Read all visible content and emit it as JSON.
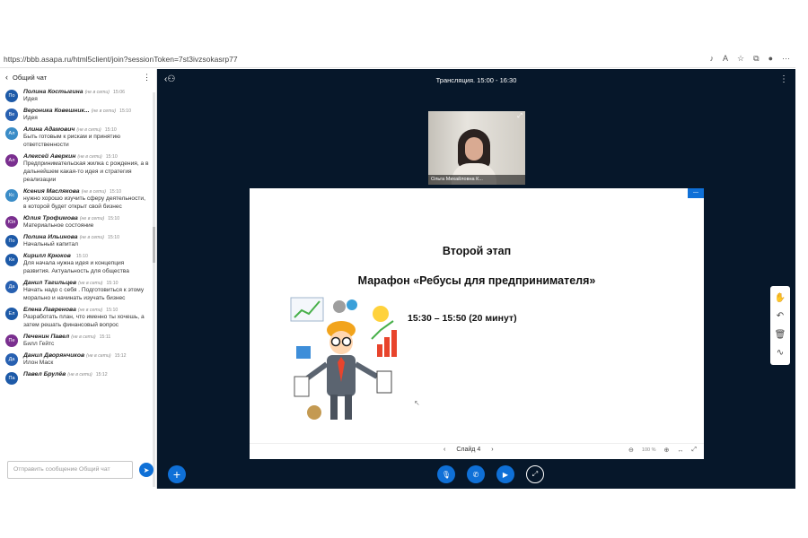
{
  "browser": {
    "url": "https://bbb.asapa.ru/html5client/join?sessionToken=7st3ivzsokasrp77",
    "icons": [
      "microphone-icon",
      "reading-icon",
      "favorite-icon",
      "collections-icon",
      "profile-icon",
      "more-icon"
    ]
  },
  "chat": {
    "back_symbol": "‹",
    "title": "Общий чат",
    "messages": [
      {
        "initials": "По",
        "color": "#1d5aa8",
        "name": "Полина Костыгина",
        "status": "(не в сети)",
        "time": "15:06",
        "text": "Идея"
      },
      {
        "initials": "Ве",
        "color": "#2760b1",
        "name": "Вероника Ковешник...",
        "status": "(не в сети)",
        "time": "15:10",
        "text": "Идея"
      },
      {
        "initials": "Ал",
        "color": "#3a8cc7",
        "name": "Алина Адамович",
        "status": "(не в сети)",
        "time": "15:10",
        "text": "Быть готовым к рискам и принятию ответственности"
      },
      {
        "initials": "Ал",
        "color": "#7a2f8f",
        "name": "Алексей Аверкин",
        "status": "(не в сети)",
        "time": "15:10",
        "text": "Предпринимательская жилка с рождения, а в дальнейшем какая-то идея и стратегия реализации"
      },
      {
        "initials": "Кс",
        "color": "#3a8cc7",
        "name": "Ксения Маслякова",
        "status": "(не в сети)",
        "time": "15:10",
        "text": "нужно хорошо изучить сферу деятельности, в которой будет открыт свой бизнес"
      },
      {
        "initials": "Юл",
        "color": "#7a2f8f",
        "name": "Юлия Трофимова",
        "status": "(не в сети)",
        "time": "15:10",
        "text": "Материальное состояние"
      },
      {
        "initials": "По",
        "color": "#1d5aa8",
        "name": "Полина Ильинова",
        "status": "(не в сети)",
        "time": "15:10",
        "text": "Начальный капитал"
      },
      {
        "initials": "Ки",
        "color": "#1d5aa8",
        "name": "Кирилл Крюков",
        "status": "",
        "time": "15:10",
        "text": "Для начала нужна идея и концепция развития. Актуальность для общества"
      },
      {
        "initials": "Да",
        "color": "#2760b1",
        "name": "Данил Тагильцев",
        "status": "(не в сети)",
        "time": "15:10",
        "text": "Начать надо с себя . Подготовиться к этому морально и начинать изучать бизнес"
      },
      {
        "initials": "Ел",
        "color": "#1d5aa8",
        "name": "Елена Лавренова",
        "status": "(не в сети)",
        "time": "15:10",
        "text": "Разработать план, что именно ты хочешь, а затем решать финансовый вопрос"
      },
      {
        "initials": "Пе",
        "color": "#7a2f8f",
        "name": "Печенин Павел",
        "status": "(не в сети)",
        "time": "15:11",
        "text": "Билл Гейтс"
      },
      {
        "initials": "Да",
        "color": "#2760b1",
        "name": "Данил Дворянчиков",
        "status": "(не в сети)",
        "time": "15:12",
        "text": "Илон Маск"
      },
      {
        "initials": "Па",
        "color": "#1d5aa8",
        "name": "Павел Брулёв",
        "status": "(не в сети)",
        "time": "15:12",
        "text": ""
      }
    ],
    "input_placeholder": "Отправить сообщение Общий чат"
  },
  "conference": {
    "title": "Трансляция. 15:00 - 16:30",
    "webcam_name": "Ольга Михайловна К...",
    "slide": {
      "heading": "Второй этап",
      "subheading": "Марафон «Ребусы для предпринимателя»",
      "time": "15:30 – 15:50 (20 минут)"
    },
    "slide_nav": {
      "prev": "‹",
      "label": "Слайд 4",
      "next": "›",
      "zoom_out": "⊖",
      "zoom": "100 %",
      "zoom_in": "⊕",
      "fit": "↔",
      "fullscreen": "⤢"
    },
    "tool_icons": [
      "hand-icon",
      "undo-icon",
      "trash-icon",
      "multi-user-draw-icon"
    ],
    "tool_glyphs": [
      "✋",
      "↶",
      "🗑",
      "∿"
    ],
    "controls": {
      "plus": "+",
      "mic": "🎙",
      "phone": "✆",
      "video": "▶",
      "share": "⤢"
    }
  }
}
